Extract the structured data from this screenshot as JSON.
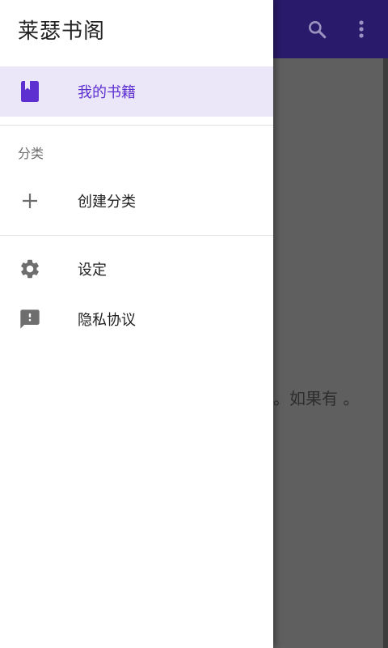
{
  "app": {
    "toolbar_color": "#2a1a6b",
    "empty_message": "籍。如果有 。",
    "icons": {
      "search": "search-icon",
      "overflow": "more-vert-icon"
    }
  },
  "drawer": {
    "title": "莱瑟书阁",
    "accent_color": "#5d2fd1",
    "items": [
      {
        "label": "我的书籍",
        "icon": "book-icon",
        "active": true
      }
    ],
    "category_section": {
      "header": "分类",
      "items": [
        {
          "label": "创建分类",
          "icon": "plus-icon"
        }
      ]
    },
    "footer_items": [
      {
        "label": "设定",
        "icon": "gear-icon"
      },
      {
        "label": "隐私协议",
        "icon": "feedback-icon"
      }
    ]
  }
}
